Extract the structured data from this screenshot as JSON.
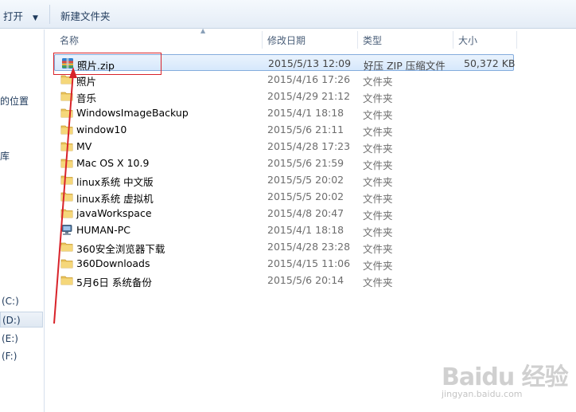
{
  "toolbar": {
    "open_label": "打开",
    "open_arrow": "▼",
    "new_folder_label": "新建文件夹"
  },
  "nav": {
    "items": [
      {
        "label": "的位置"
      },
      {
        "label": "库"
      },
      {
        "label": "(C:)"
      },
      {
        "label": "(D:)"
      },
      {
        "label": "(E:)"
      },
      {
        "label": "(F:)"
      }
    ]
  },
  "columns": {
    "name": "名称",
    "date": "修改日期",
    "type": "类型",
    "size": "大小"
  },
  "files": [
    {
      "name": "照片.zip",
      "date": "2015/5/13 12:09",
      "type": "好压 ZIP 压缩文件",
      "size": "50,372 KB",
      "icon": "zip-archive-icon"
    },
    {
      "name": "照片",
      "date": "2015/4/16 17:26",
      "type": "文件夹",
      "size": "",
      "icon": "folder-icon"
    },
    {
      "name": "音乐",
      "date": "2015/4/29 21:12",
      "type": "文件夹",
      "size": "",
      "icon": "folder-icon"
    },
    {
      "name": "WindowsImageBackup",
      "date": "2015/4/1 18:18",
      "type": "文件夹",
      "size": "",
      "icon": "folder-icon"
    },
    {
      "name": "window10",
      "date": "2015/5/6 21:11",
      "type": "文件夹",
      "size": "",
      "icon": "folder-icon"
    },
    {
      "name": "MV",
      "date": "2015/4/28 17:23",
      "type": "文件夹",
      "size": "",
      "icon": "folder-icon"
    },
    {
      "name": "Mac OS X 10.9",
      "date": "2015/5/6 21:59",
      "type": "文件夹",
      "size": "",
      "icon": "folder-icon"
    },
    {
      "name": "linux系统  中文版",
      "date": "2015/5/5 20:02",
      "type": "文件夹",
      "size": "",
      "icon": "folder-icon"
    },
    {
      "name": "linux系统  虚拟机",
      "date": "2015/5/5 20:02",
      "type": "文件夹",
      "size": "",
      "icon": "folder-icon"
    },
    {
      "name": "javaWorkspace",
      "date": "2015/4/8 20:47",
      "type": "文件夹",
      "size": "",
      "icon": "folder-icon"
    },
    {
      "name": "HUMAN-PC",
      "date": "2015/4/1 18:18",
      "type": "文件夹",
      "size": "",
      "icon": "network-computer-icon"
    },
    {
      "name": "360安全浏览器下载",
      "date": "2015/4/28 23:28",
      "type": "文件夹",
      "size": "",
      "icon": "folder-icon"
    },
    {
      "name": "360Downloads",
      "date": "2015/4/15 11:06",
      "type": "文件夹",
      "size": "",
      "icon": "folder-icon"
    },
    {
      "name": "5月6日 系统备份",
      "date": "2015/5/6 20:14",
      "type": "文件夹",
      "size": "",
      "icon": "folder-icon"
    }
  ],
  "watermark": {
    "logo": "Baidu 经验",
    "url": "jingyan.baidu.com"
  },
  "colors": {
    "annotation": "#d8232a",
    "selection_border": "#84acdd",
    "text_primary": "#000000",
    "text_secondary": "#6d6d6d"
  }
}
